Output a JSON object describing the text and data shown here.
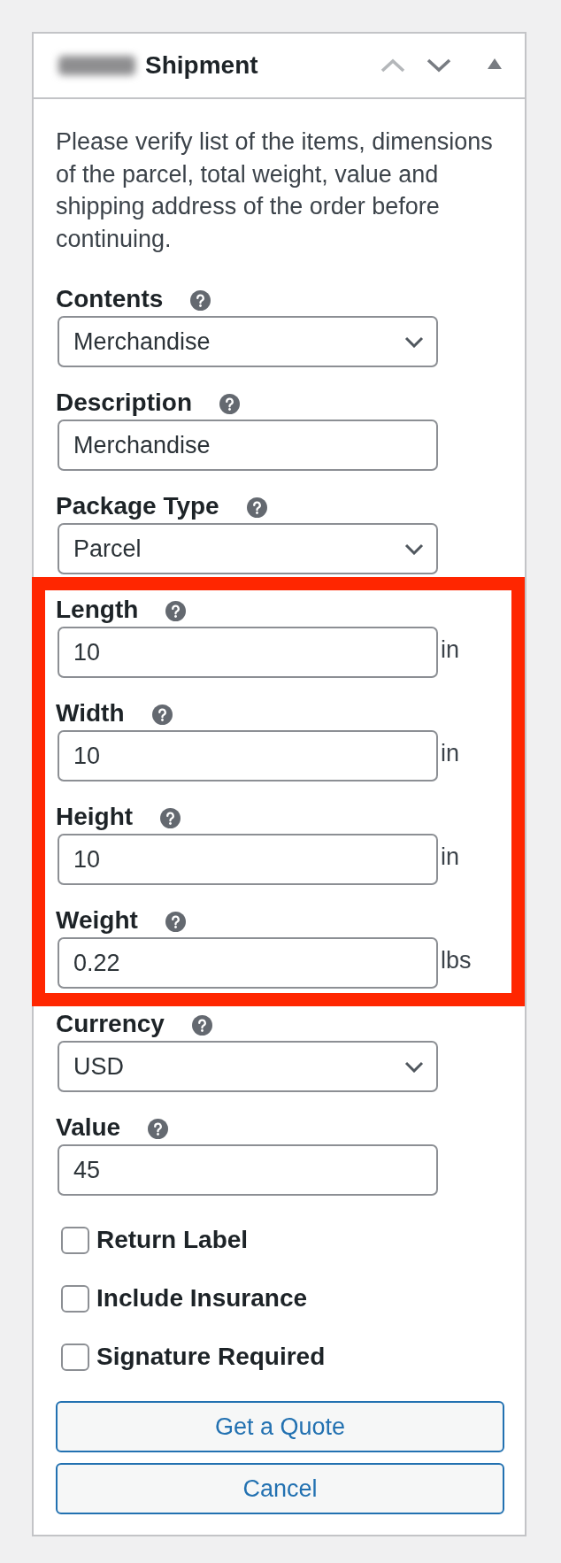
{
  "panel": {
    "redacted_prefix": true,
    "title": "Shipment",
    "controls": [
      {
        "kind": "move-up",
        "disabled": true
      },
      {
        "kind": "move-down",
        "disabled": false
      },
      {
        "kind": "collapse",
        "disabled": false
      }
    ]
  },
  "intro": "Please verify list of the items, dimensions of the parcel, total weight, value and shipping address of the order before continuing.",
  "sections": [
    {
      "highlighted": false,
      "fields": [
        {
          "kind": "select",
          "label": "Contents",
          "help": true,
          "value": "Merchandise"
        },
        {
          "kind": "text",
          "label": "Description",
          "help": true,
          "value": "Merchandise"
        },
        {
          "kind": "select",
          "label": "Package Type",
          "help": true,
          "value": "Parcel"
        }
      ]
    },
    {
      "highlighted": true,
      "fields": [
        {
          "kind": "text",
          "label": "Length",
          "help": true,
          "value": "10",
          "unit": "in"
        },
        {
          "kind": "text",
          "label": "Width",
          "help": true,
          "value": "10",
          "unit": "in"
        },
        {
          "kind": "text",
          "label": "Height",
          "help": true,
          "value": "10",
          "unit": "in"
        },
        {
          "kind": "text",
          "label": "Weight",
          "help": true,
          "value": "0.22",
          "unit": "lbs"
        }
      ]
    },
    {
      "highlighted": false,
      "fields": [
        {
          "kind": "select",
          "label": "Currency",
          "help": true,
          "value": "USD"
        },
        {
          "kind": "text",
          "label": "Value",
          "help": true,
          "value": "45"
        }
      ]
    }
  ],
  "checkboxes": [
    {
      "label": "Return Label",
      "checked": false
    },
    {
      "label": "Include Insurance",
      "checked": false
    },
    {
      "label": "Signature Required",
      "checked": false
    }
  ],
  "buttons": [
    "Get a Quote",
    "Cancel"
  ]
}
